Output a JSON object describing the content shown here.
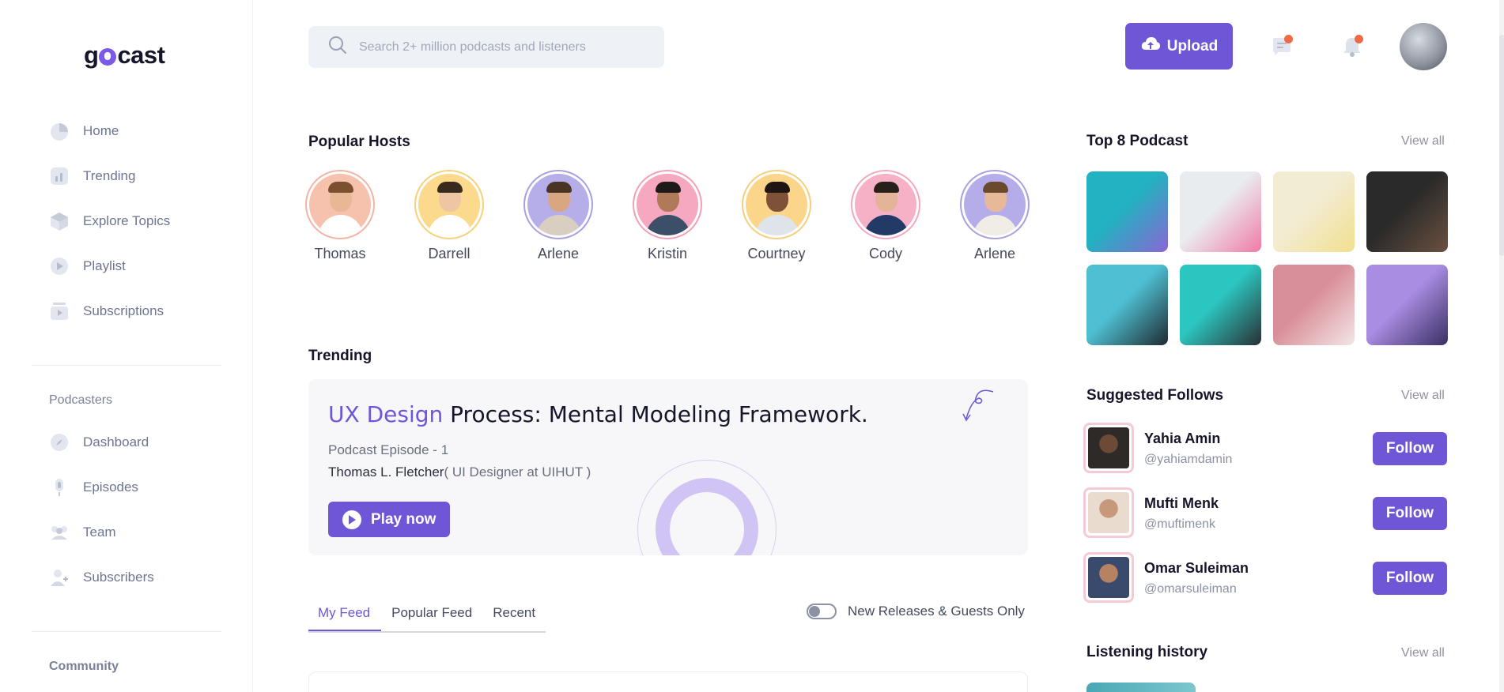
{
  "app": {
    "logo_text_1": "g",
    "logo_text_2": "cast"
  },
  "sidebar": {
    "items": [
      {
        "label": "Home",
        "icon": "pie-chart-icon"
      },
      {
        "label": "Trending",
        "icon": "bar-chart-icon"
      },
      {
        "label": "Explore Topics",
        "icon": "cube-icon"
      },
      {
        "label": "Playlist",
        "icon": "play-circle-icon"
      },
      {
        "label": "Subscriptions",
        "icon": "subscriptions-icon"
      }
    ],
    "podcasters_title": "Podcasters",
    "podcaster_items": [
      {
        "label": "Dashboard",
        "icon": "compass-icon"
      },
      {
        "label": "Episodes",
        "icon": "microphone-icon"
      },
      {
        "label": "Team",
        "icon": "team-icon"
      },
      {
        "label": "Subscribers",
        "icon": "add-user-icon"
      }
    ],
    "community_title": "Community"
  },
  "header": {
    "search_placeholder": "Search 2+ million podcasts and listeners",
    "upload_label": "Upload",
    "icons": [
      "chat-icon",
      "bell-icon"
    ]
  },
  "popular_hosts": {
    "title": "Popular Hosts",
    "hosts": [
      {
        "name": "Thomas",
        "ring": "#f4b4a3",
        "bg": "#f6c1ad",
        "shirt": "#ffffff",
        "hair": "#7a5030",
        "skin": "#e8b795"
      },
      {
        "name": "Darrell",
        "ring": "#f7d27a",
        "bg": "#fbd98d",
        "shirt": "#ffffff",
        "hair": "#3a2a1e",
        "skin": "#efc6a3"
      },
      {
        "name": "Arlene",
        "ring": "#a7a1e0",
        "bg": "#b6aee9",
        "shirt": "#d9cfc0",
        "hair": "#4a3424",
        "skin": "#d9a682"
      },
      {
        "name": "Kristin",
        "ring": "#f3a0b7",
        "bg": "#f5a8bf",
        "shirt": "#3b5068",
        "hair": "#1e1a18",
        "skin": "#b07a58"
      },
      {
        "name": "Courtney",
        "ring": "#f5cf7d",
        "bg": "#fbd58a",
        "shirt": "#dfe4ea",
        "hair": "#1d1612",
        "skin": "#7e5238"
      },
      {
        "name": "Cody",
        "ring": "#f5a8bf",
        "bg": "#f7b1c6",
        "shirt": "#243a66",
        "hair": "#2a201a",
        "skin": "#e3b497"
      },
      {
        "name": "Arlene",
        "ring": "#a7a1e0",
        "bg": "#b5adea",
        "shirt": "#f0ece6",
        "hair": "#6a4a2c",
        "skin": "#e7b999"
      }
    ]
  },
  "trending": {
    "title": "Trending",
    "card": {
      "title_accent": "UX Design",
      "title_rest": " Process: Mental Modeling Framework.",
      "episode": "Podcast Episode - 1",
      "host": "Thomas L. Fletcher",
      "role": "( UI Designer at UIHUT )",
      "play_label": "Play now"
    }
  },
  "feed": {
    "tabs": [
      "My Feed",
      "Popular Feed",
      "Recent"
    ],
    "active_tab": "My Feed",
    "toggle_label": "New Releases & Guests Only",
    "toggle_on": false
  },
  "top_podcast": {
    "title": "Top 8 Podcast",
    "view_all": "View all",
    "thumbs": [
      {
        "name": "podcast-thumb-1",
        "colors": [
          "#22b2c1",
          "#8a66d4"
        ]
      },
      {
        "name": "podcast-thumb-2",
        "colors": [
          "#e9ecef",
          "#f07aa6"
        ]
      },
      {
        "name": "podcast-thumb-3",
        "colors": [
          "#f2ecd2",
          "#f1e08f"
        ]
      },
      {
        "name": "podcast-thumb-4",
        "colors": [
          "#2a2a2a",
          "#6b5140"
        ]
      },
      {
        "name": "podcast-thumb-5",
        "colors": [
          "#4fc0d3",
          "#1f2a30"
        ]
      },
      {
        "name": "podcast-thumb-6",
        "colors": [
          "#2cc6c0",
          "#2a2f33"
        ]
      },
      {
        "name": "podcast-thumb-7",
        "colors": [
          "#d98f99",
          "#f3e6e6"
        ]
      },
      {
        "name": "podcast-thumb-8",
        "colors": [
          "#a98de3",
          "#3a2f62"
        ]
      }
    ]
  },
  "suggested_follows": {
    "title": "Suggested Follows",
    "view_all": "View all",
    "follow_label": "Follow",
    "people": [
      {
        "name": "Yahia Amin",
        "handle": "@yahiamdamin",
        "bg": "#2d2a28",
        "skin": "#6c4a35"
      },
      {
        "name": "Mufti Menk",
        "handle": "@muftimenk",
        "bg": "#e9dccf",
        "skin": "#c7997a"
      },
      {
        "name": "Omar Suleiman",
        "handle": "@omarsuleiman",
        "bg": "#3a4a6c",
        "skin": "#b68362"
      }
    ]
  },
  "listening_history": {
    "title": "Listening history",
    "view_all": "View all"
  },
  "colors": {
    "accent": "#6e56d6",
    "notification": "#f06a45"
  }
}
